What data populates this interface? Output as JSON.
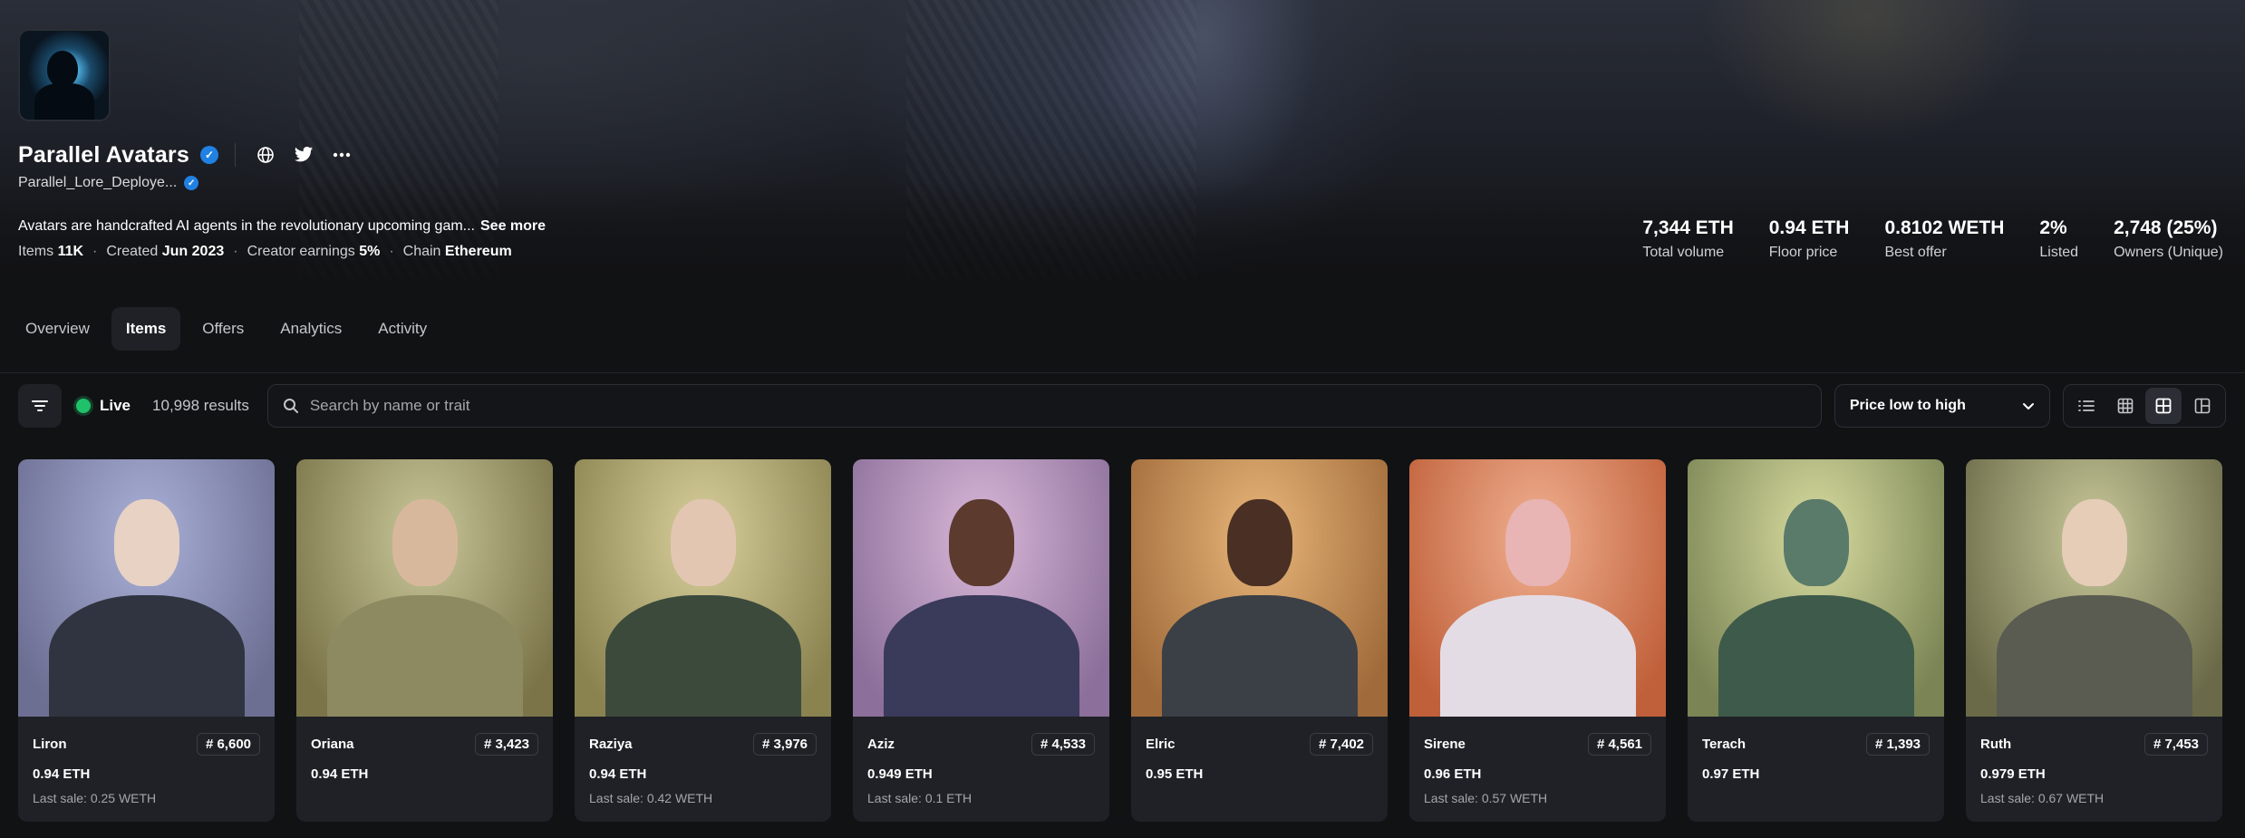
{
  "collection": {
    "name": "Parallel Avatars",
    "creator": "Parallel_Lore_Deploye...",
    "description": "Avatars are handcrafted AI agents in the revolutionary upcoming gam...",
    "see_more": "See more",
    "meta": [
      {
        "label": "Items",
        "value": "11K"
      },
      {
        "label": "Created",
        "value": "Jun 2023"
      },
      {
        "label": "Creator earnings",
        "value": "5%"
      },
      {
        "label": "Chain",
        "value": "Ethereum"
      }
    ],
    "meta_sep": "·",
    "icons": [
      "verified-badge-icon",
      "globe-icon",
      "twitter-icon",
      "more-icon"
    ]
  },
  "stats": [
    {
      "value": "7,344 ETH",
      "label": "Total volume"
    },
    {
      "value": "0.94 ETH",
      "label": "Floor price"
    },
    {
      "value": "0.8102 WETH",
      "label": "Best offer"
    },
    {
      "value": "2%",
      "label": "Listed"
    },
    {
      "value": "2,748 (25%)",
      "label": "Owners (Unique)"
    }
  ],
  "tabs": [
    {
      "label": "Overview",
      "active": false
    },
    {
      "label": "Items",
      "active": true
    },
    {
      "label": "Offers",
      "active": false
    },
    {
      "label": "Analytics",
      "active": false
    },
    {
      "label": "Activity",
      "active": false
    }
  ],
  "toolbar": {
    "live_label": "Live",
    "results": "10,998 results",
    "search_placeholder": "Search by name or trait",
    "sort_label": "Price low to high",
    "views": [
      "list-view-icon",
      "grid-small-icon",
      "grid-large-icon",
      "gallery-view-icon"
    ],
    "active_view": 2,
    "live_color": "#1fc16b"
  },
  "items": [
    {
      "name": "Liron",
      "number": "# 6,600",
      "price": "0.94 ETH",
      "last_sale": "Last sale: 0.25 WETH",
      "bg": [
        "#aab0d8",
        "#6c6f92"
      ],
      "skin": "#e7d2c4",
      "outfit": "#2f3440"
    },
    {
      "name": "Oriana",
      "number": "# 3,423",
      "price": "0.94 ETH",
      "last_sale": "",
      "bg": [
        "#c9c79a",
        "#7a7448"
      ],
      "skin": "#d8b89c",
      "outfit": "#8d8a62"
    },
    {
      "name": "Raziya",
      "number": "# 3,976",
      "price": "0.94 ETH",
      "last_sale": "Last sale: 0.42 WETH",
      "bg": [
        "#d8cf9c",
        "#8a8350"
      ],
      "skin": "#e2c6b2",
      "outfit": "#3c4a3c"
    },
    {
      "name": "Aziz",
      "number": "# 4,533",
      "price": "0.949 ETH",
      "last_sale": "Last sale: 0.1 ETH",
      "bg": [
        "#d8b8d8",
        "#8c6f9a"
      ],
      "skin": "#5c3a2e",
      "outfit": "#3a3a5a"
    },
    {
      "name": "Elric",
      "number": "# 7,402",
      "price": "0.95 ETH",
      "last_sale": "",
      "bg": [
        "#e8b67a",
        "#a06a3a"
      ],
      "skin": "#4a3024",
      "outfit": "#3b3f46"
    },
    {
      "name": "Sirene",
      "number": "# 4,561",
      "price": "0.96 ETH",
      "last_sale": "Last sale: 0.57 WETH",
      "bg": [
        "#f0b090",
        "#c0603a"
      ],
      "skin": "#e8b4b4",
      "outfit": "#e4dce4"
    },
    {
      "name": "Terach",
      "number": "# 1,393",
      "price": "0.97 ETH",
      "last_sale": "",
      "bg": [
        "#d8dca0",
        "#7a8454"
      ],
      "skin": "#5a7a6a",
      "outfit": "#3e5a4a"
    },
    {
      "name": "Ruth",
      "number": "# 7,453",
      "price": "0.979 ETH",
      "last_sale": "Last sale: 0.67 WETH",
      "bg": [
        "#c8c89a",
        "#6a6a48"
      ],
      "skin": "#e6cdb8",
      "outfit": "#5a5c52"
    }
  ]
}
